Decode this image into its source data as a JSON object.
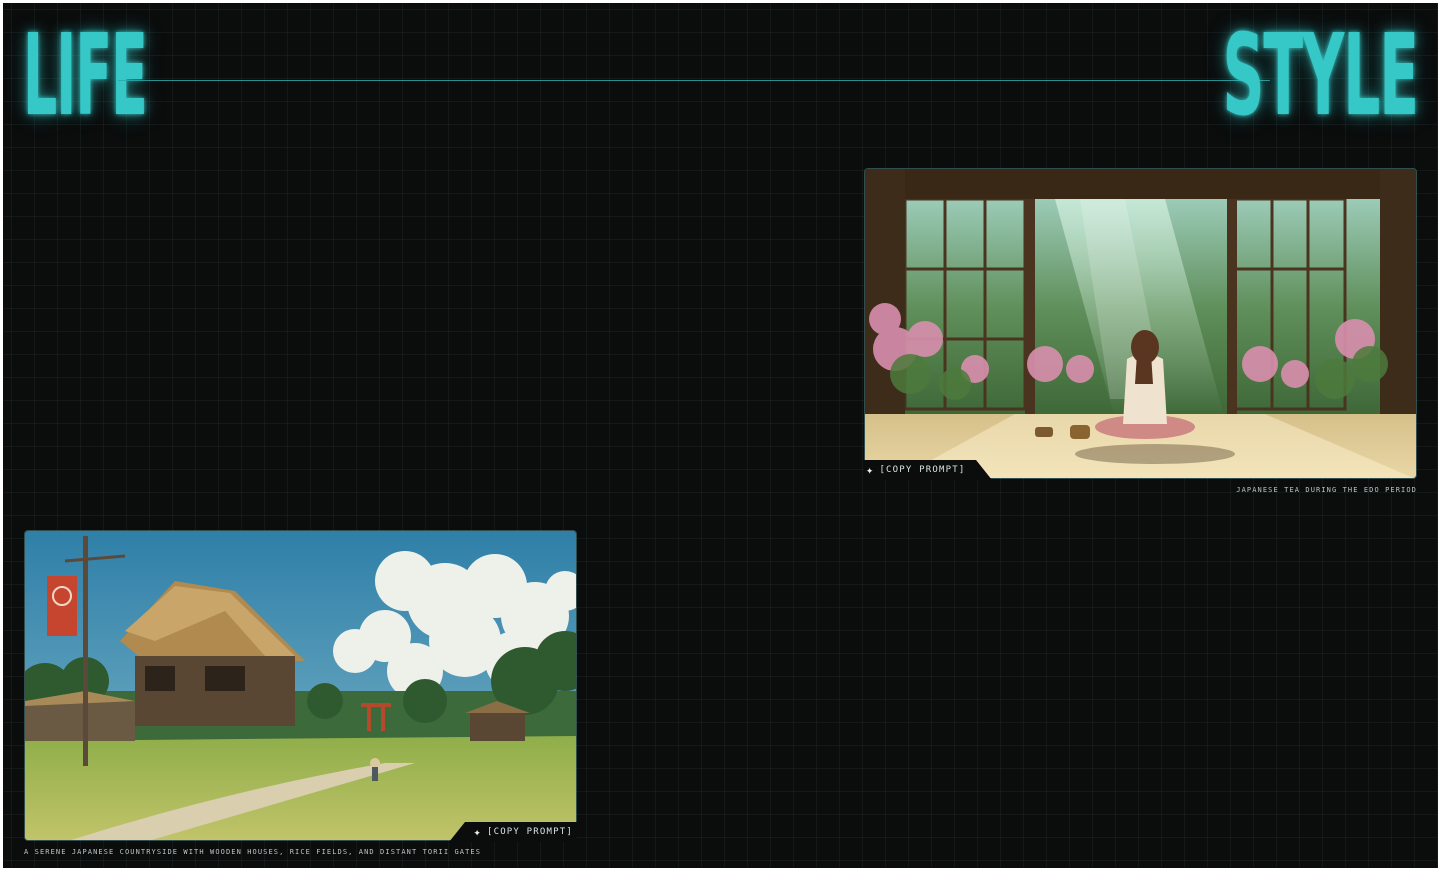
{
  "header": {
    "left_word": "LIFE",
    "right_word": "STYLE"
  },
  "colors": {
    "accent": "#36c7c7",
    "background": "#0b0c0c",
    "grid": "#1e2b2b"
  },
  "cards": [
    {
      "copy_label": "[COPY PROMPT]",
      "copy_icon": "sparkle-icon",
      "caption": "JAPANESE TEA DURING THE EDO PERIOD"
    },
    {
      "copy_label": "[COPY PROMPT]",
      "copy_icon": "sparkle-icon",
      "caption": "A SERENE JAPANESE COUNTRYSIDE WITH WOODEN HOUSES, RICE FIELDS, AND DISTANT TORII GATES"
    }
  ]
}
